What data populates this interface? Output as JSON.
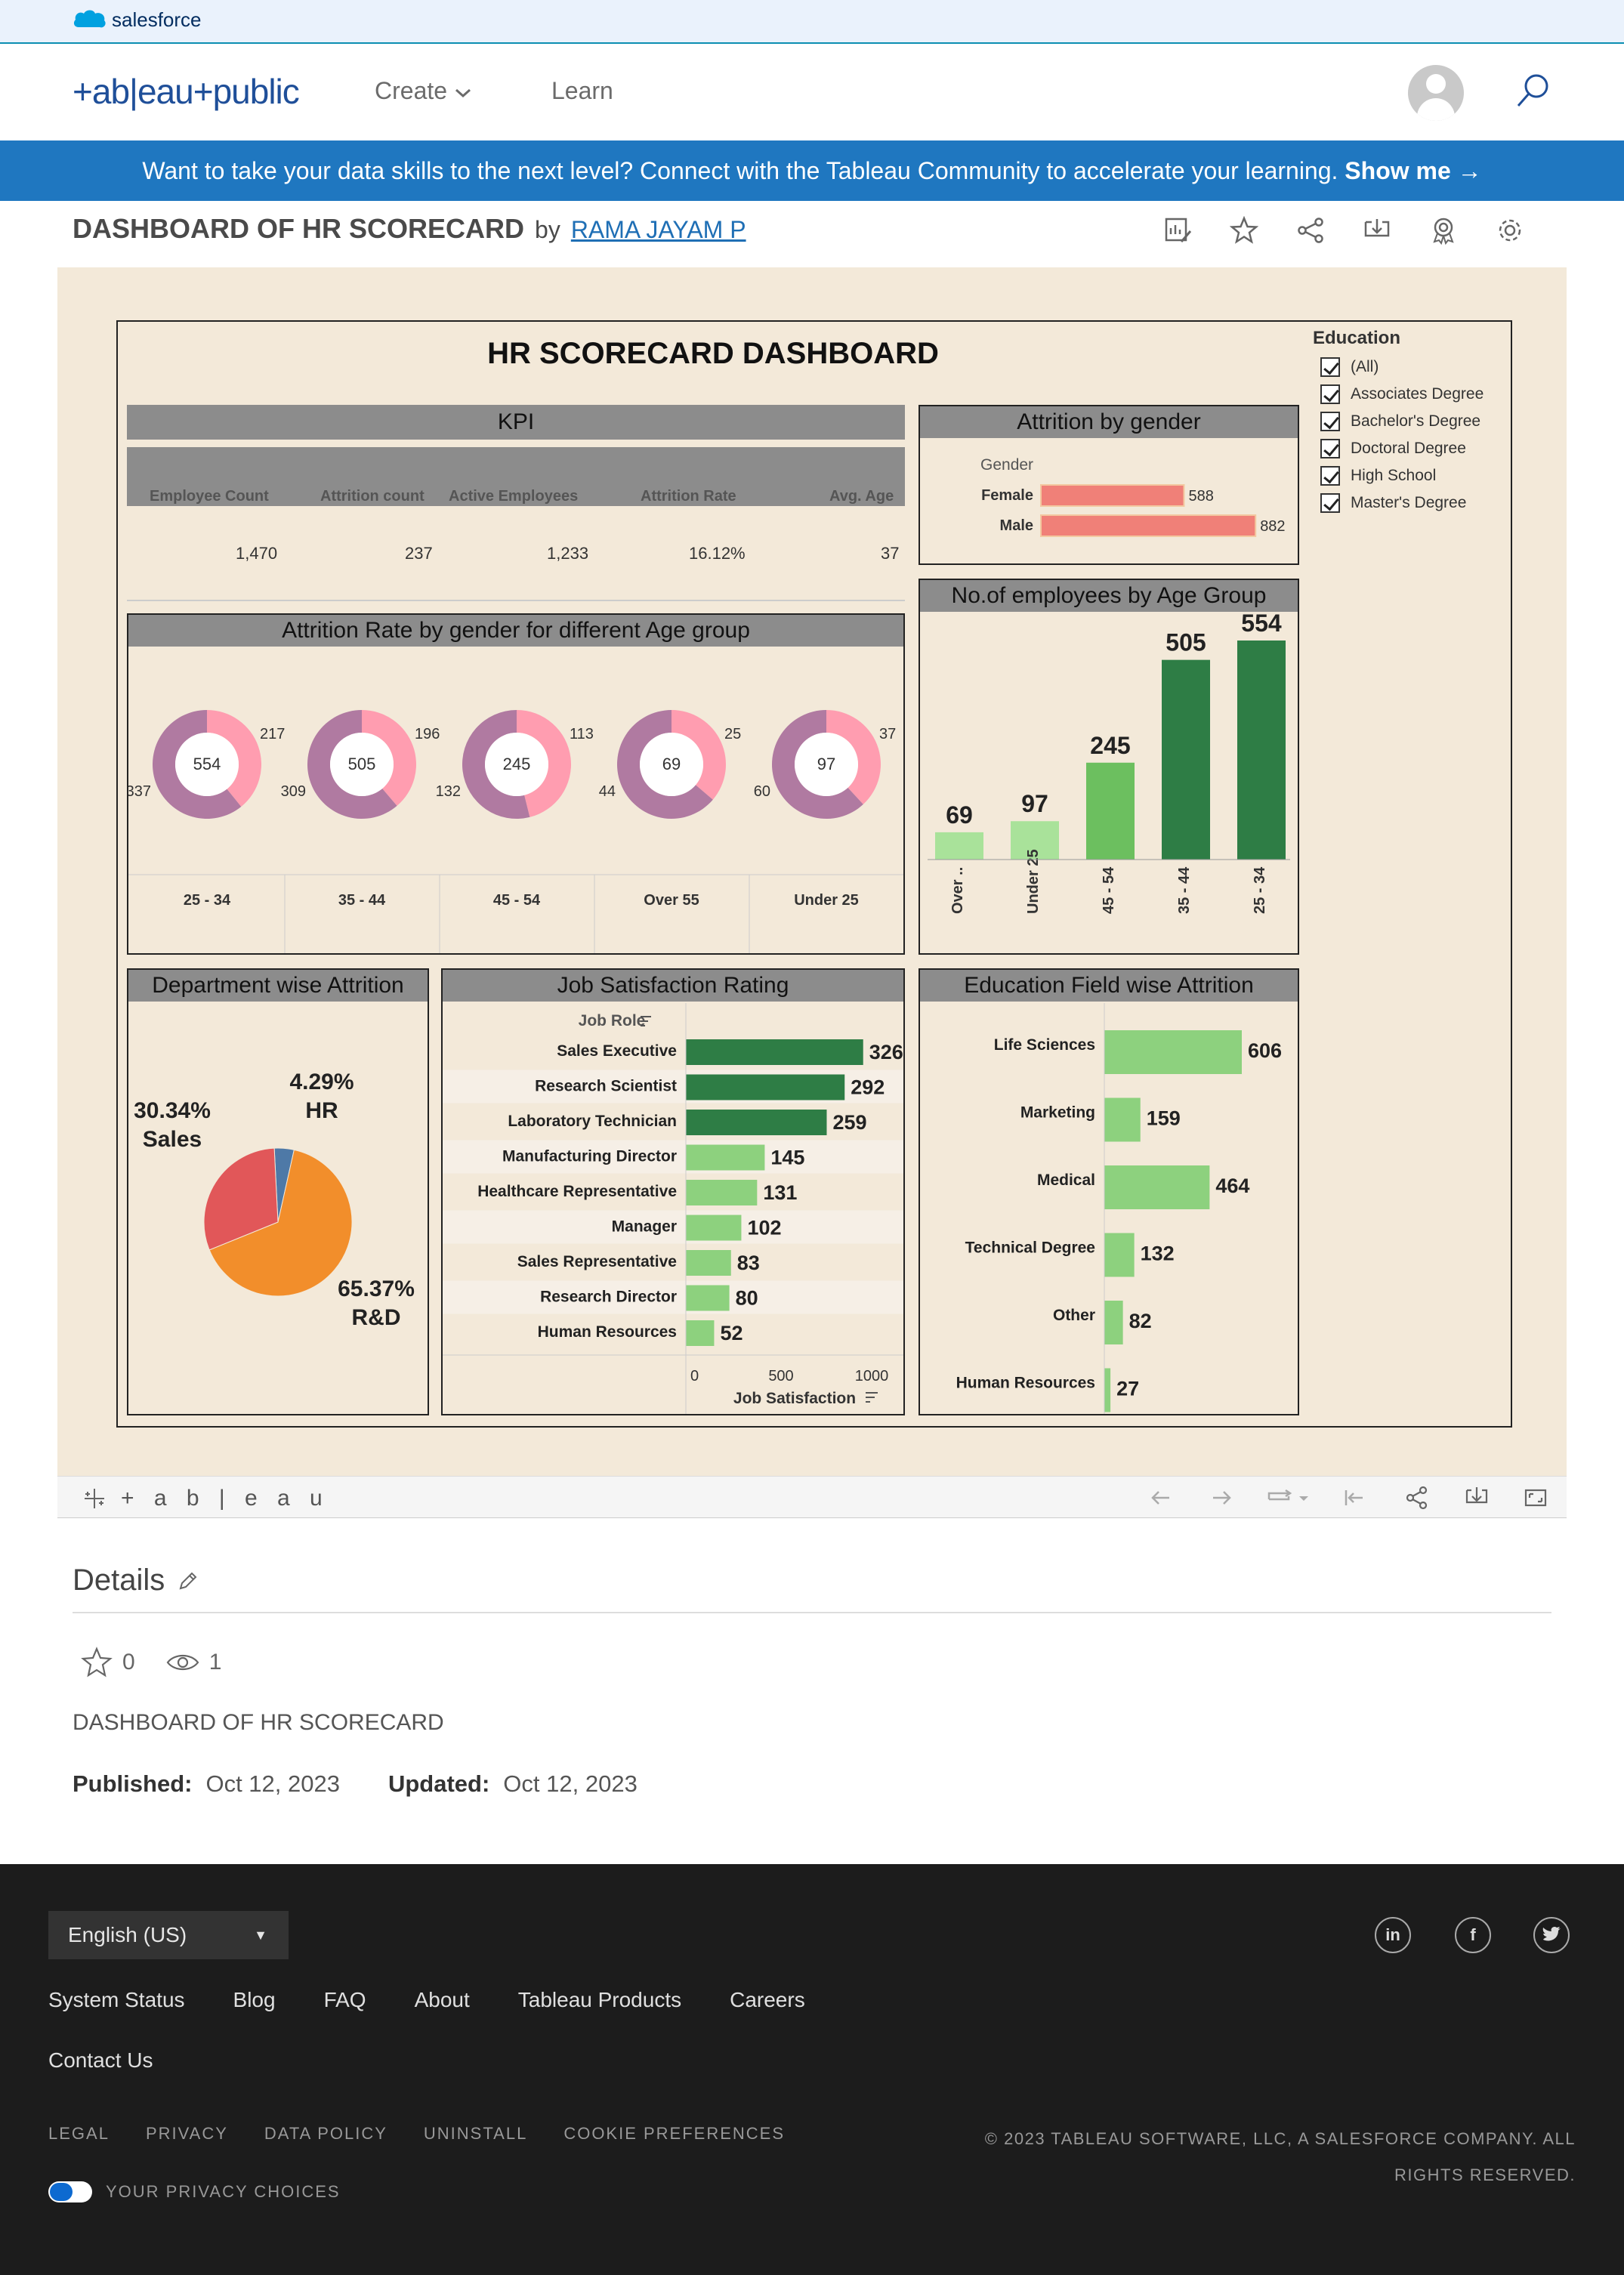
{
  "salesforce": {
    "brand": "salesforce"
  },
  "nav": {
    "logo": "+ab|eau+public",
    "create": "Create",
    "learn": "Learn"
  },
  "banner": {
    "text": "Want to take your data skills to the next level? Connect with the Tableau Community to accelerate your learning.",
    "cta": "Show me →"
  },
  "viz": {
    "title": "DASHBOARD OF HR SCORECARD",
    "by": "by",
    "author": "RAMA JAYAM P"
  },
  "dashboard": {
    "title": "HR SCORECARD DASHBOARD",
    "kpi": {
      "header": "KPI",
      "labels": [
        "Employee Count",
        "Attrition count",
        "Active Employees",
        "Attrition Rate",
        "Avg. Age"
      ],
      "values": [
        "1,470",
        "237",
        "1,233",
        "16.12%",
        "37"
      ]
    },
    "education_filter": {
      "title": "Education",
      "options": [
        "(All)",
        "Associates Degree",
        "Bachelor's Degree",
        "Doctoral Degree",
        "High School",
        "Master's Degree"
      ]
    }
  },
  "chart_data": [
    {
      "type": "bar",
      "title": "Attrition by gender",
      "ylabel": "Gender",
      "categories": [
        "Female",
        "Male"
      ],
      "values": [
        588,
        882
      ],
      "color": "#f08078"
    },
    {
      "type": "pie",
      "title": "Attrition Rate by gender for different Age group",
      "groups": [
        {
          "label": "25 - 34",
          "total": 554,
          "female": 217,
          "male": 337
        },
        {
          "label": "35 - 44",
          "total": 505,
          "female": 196,
          "male": 309
        },
        {
          "label": "45 - 54",
          "total": 245,
          "female": 113,
          "male": 132
        },
        {
          "label": "Over 55",
          "total": 69,
          "female": 25,
          "male": 44
        },
        {
          "label": "Under 25",
          "total": 97,
          "female": 37,
          "male": 60
        }
      ]
    },
    {
      "type": "bar",
      "title": "No.of employees by Age Group",
      "categories": [
        "Over ..",
        "Under 25",
        "45 - 54",
        "35 - 44",
        "25 - 34"
      ],
      "values": [
        69,
        97,
        245,
        505,
        554
      ]
    },
    {
      "type": "pie",
      "title": "Department wise Attrition",
      "slices": [
        {
          "label": "R&D",
          "pct": "65.37%",
          "value": 65.37,
          "color": "#f28e2b"
        },
        {
          "label": "Sales",
          "pct": "30.34%",
          "value": 30.34,
          "color": "#e15759"
        },
        {
          "label": "HR",
          "pct": "4.29%",
          "value": 4.29,
          "color": "#4e79a7"
        }
      ]
    },
    {
      "type": "bar",
      "title": "Job Satisfaction Rating",
      "ylabel": "Job Role",
      "xlabel": "Job Satisfaction",
      "xticks": [
        "0",
        "500",
        "1000"
      ],
      "xlim": [
        0,
        1100
      ],
      "categories": [
        "Sales Executive",
        "Research Scientist",
        "Laboratory Technician",
        "Manufacturing Director",
        "Healthcare Representative",
        "Manager",
        "Sales Representative",
        "Research Director",
        "Human Resources"
      ],
      "values": [
        326,
        292,
        259,
        145,
        131,
        102,
        83,
        80,
        52
      ]
    },
    {
      "type": "bar",
      "title": "Education Field wise Attrition",
      "categories": [
        "Life Sciences",
        "Marketing",
        "Medical",
        "Technical Degree",
        "Other",
        "Human Resources"
      ],
      "values": [
        606,
        159,
        464,
        132,
        82,
        27
      ]
    }
  ],
  "tableau_footer": {
    "brand": "+ a b | e a u"
  },
  "details": {
    "title": "Details",
    "favorites": "0",
    "views": "1",
    "description": "DASHBOARD OF HR SCORECARD",
    "published_label": "Published:",
    "published": "Oct 12, 2023",
    "updated_label": "Updated:",
    "updated": "Oct 12, 2023"
  },
  "footer": {
    "language": "English (US)",
    "links": [
      "System Status",
      "Blog",
      "FAQ",
      "About",
      "Tableau Products",
      "Careers"
    ],
    "contact": "Contact Us",
    "legal": [
      "LEGAL",
      "PRIVACY",
      "DATA POLICY",
      "UNINSTALL",
      "COOKIE PREFERENCES"
    ],
    "copyright": "© 2023 TABLEAU SOFTWARE, LLC, A SALESFORCE COMPANY. ALL RIGHTS RESERVED.",
    "privacy_choices": "YOUR PRIVACY CHOICES"
  },
  "colors": {
    "banner": "#1f77c0",
    "dashboard_bg": "#f3e9d9",
    "dark_green": "#2e7d45",
    "light_green": "#8dd17e",
    "salmon": "#f08078",
    "female": "#ff9db0",
    "male": "#b07aa1"
  }
}
